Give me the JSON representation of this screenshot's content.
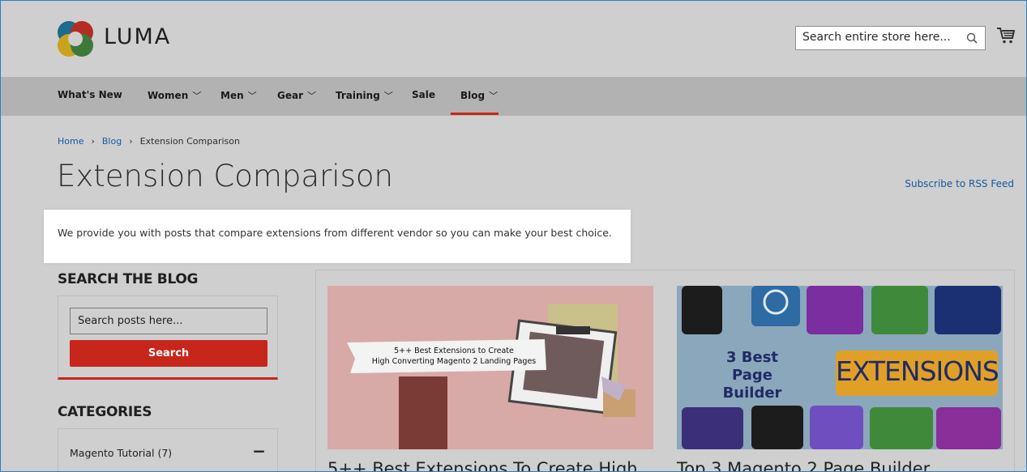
{
  "brand": {
    "name": "LUMA"
  },
  "header": {
    "search_placeholder": "Search entire store here..."
  },
  "nav": {
    "items": [
      {
        "label": "What's New",
        "has_dropdown": false
      },
      {
        "label": "Women",
        "has_dropdown": true
      },
      {
        "label": "Men",
        "has_dropdown": true
      },
      {
        "label": "Gear",
        "has_dropdown": true
      },
      {
        "label": "Training",
        "has_dropdown": true
      },
      {
        "label": "Sale",
        "has_dropdown": false
      },
      {
        "label": "Blog",
        "has_dropdown": true,
        "active": true
      }
    ],
    "chevron": "⌄"
  },
  "breadcrumb": {
    "items": [
      "Home",
      "Blog",
      "Extension Comparison"
    ],
    "separator": "›"
  },
  "page": {
    "title": "Extension Comparison",
    "rss_label": "Subscribe to RSS Feed",
    "description": "We provide you with posts that compare extensions from different vendor so you can make your best choice."
  },
  "sidebar": {
    "search_title": "SEARCH THE BLOG",
    "search_placeholder": "Search posts here...",
    "search_button": "Search",
    "categories_title": "CATEGORIES",
    "categories": [
      {
        "label": "Magento Tutorial (7)",
        "toggle": "−"
      }
    ]
  },
  "posts": [
    {
      "title": "5++ Best Extensions To Create High",
      "image_text": [
        "5++ Best Extensions to Create",
        "High Converting Magento 2 Landing Pages"
      ]
    },
    {
      "title": "Top 3 Magento 2 Page Builder",
      "image_text": [
        "3 Best",
        "Page Builder",
        "EXTENSIONS"
      ]
    }
  ],
  "colors": {
    "accent": "#c7261b",
    "link": "#1559a7",
    "overlay": "#cfcfcf"
  }
}
